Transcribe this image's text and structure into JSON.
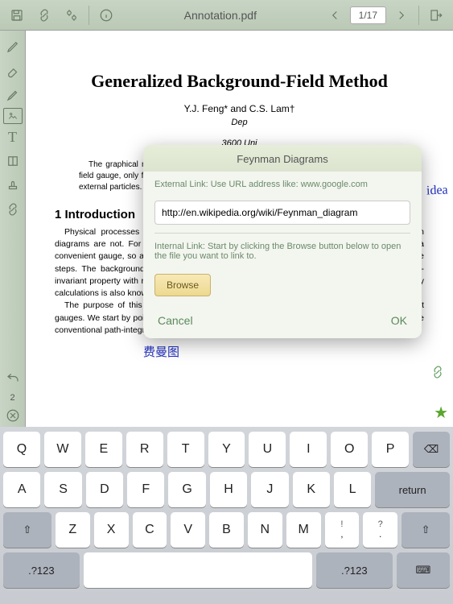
{
  "topbar": {
    "title": "Annotation.pdf",
    "page_indicator": "1/17"
  },
  "sidebar": {
    "undo_count": "2"
  },
  "document": {
    "title": "Generalized Background-Field Method",
    "authors": "Y.J. Feng* and C.S. Lam†",
    "affil_line1": "Dep",
    "affil_line2": "3600 Uni",
    "abstract": "The graphical method reachable by the path-i more efficient two-loop C background-field gauge, only four terms, not the the necessity to include field gauge, this general the external particles. A labour, an explicit calc new gauge. It results i background-field gauge.",
    "section1": "1   Introduction",
    "para1": "Physical processes in QCD are gauge independent but unfortunately individual Feynman diagrams are not. For that reason calculations may be greatly simplified with the choice of a convenient gauge, so as to minimize the presence of gauge-dependent terms in the intermediate steps. The background-field (BF) gauge [1] is one such gauge, partly because of its gauge-invariant property with respect to the external lines. The pinching technique [2, 3] used to simplify calculations is also known to be related to this gauge [4, 5].",
    "para2": "The purpose of this paper is to discuss a graphical method for designing other convenient gauges. We start by pointing out the advantage and the flexibility of the graphical method over the conventional path-integral or operator technique."
  },
  "annotations": {
    "handwrite1": "idea",
    "handwrite2": "费曼图"
  },
  "popup": {
    "title": "Feynman Diagrams",
    "external_hint": "External Link: Use URL address like: www.google.com",
    "url_value": "http://en.wikipedia.org/wiki/Feynman_diagram",
    "internal_hint": "Internal Link: Start by clicking the Browse button below to open the file you want to link to.",
    "browse": "Browse",
    "cancel": "Cancel",
    "ok": "OK"
  },
  "keyboard": {
    "row1": [
      "Q",
      "W",
      "E",
      "R",
      "T",
      "Y",
      "U",
      "I",
      "O",
      "P"
    ],
    "row2": [
      "A",
      "S",
      "D",
      "F",
      "G",
      "H",
      "J",
      "K",
      "L"
    ],
    "row3": [
      "Z",
      "X",
      "C",
      "V",
      "B",
      "N",
      "M"
    ],
    "punct": [
      [
        "!",
        ",",
        "!\n,"
      ],
      [
        "?",
        ".",
        "?\n."
      ]
    ],
    "backspace": "⌫",
    "return": "return",
    "shift": "⇧",
    "mode": ".?123",
    "hide": "⌨"
  }
}
